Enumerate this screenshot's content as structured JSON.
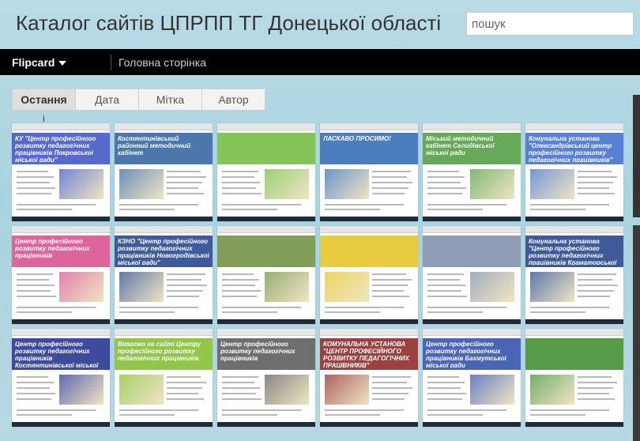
{
  "header": {
    "title": "Каталог сайтів ЦПРПП ТГ Донецької області",
    "search_placeholder": "пошук"
  },
  "navbar": {
    "view_label": "Flipcard",
    "home_label": "Головна сторінка"
  },
  "tabs": [
    {
      "label": "Остання",
      "active": true
    },
    {
      "label": "Дата",
      "active": false
    },
    {
      "label": "Мітка",
      "active": false
    },
    {
      "label": "Автор",
      "active": false
    }
  ],
  "tab_marker": "i",
  "cards": [
    {
      "name": "card-1",
      "headline": "КУ \"Центр професійного розвитку педагогічних працівників Покровської міської ради\"",
      "accent": "#3a4fc2"
    },
    {
      "name": "card-2",
      "headline": "Костянтинівський районний методичний кабінет",
      "accent": "#2c5f9e"
    },
    {
      "name": "card-3",
      "headline": "",
      "accent": "#6fba3c"
    },
    {
      "name": "card-4",
      "headline": "ЛАСКАВО ПРОСИМО!",
      "accent": "#2b67b3"
    },
    {
      "name": "card-5",
      "headline": "Міський методичний кабінет Селидівської міської ради",
      "accent": "#4a9a3c"
    },
    {
      "name": "card-6",
      "headline": "Комунальна установа \"Олександрівський центр професійного розвитку педагогічних працівників\"",
      "accent": "#3b6bc9"
    },
    {
      "name": "card-7",
      "headline": "Центр професійного розвитку педагогічних працівників",
      "accent": "#d84a8a"
    },
    {
      "name": "card-8",
      "headline": "КЗНО \"Центр професійного розвитку педагогічних працівників Новогродівської міської ради\"",
      "accent": "#1f3e8a"
    },
    {
      "name": "card-9",
      "headline": "",
      "accent": "#6c8c3a"
    },
    {
      "name": "card-10",
      "headline": "",
      "accent": "#e4c21c"
    },
    {
      "name": "card-11",
      "headline": "",
      "accent": "#7c8aa8"
    },
    {
      "name": "card-12",
      "headline": "Комунальна установа \"Центр професійного розвитку педагогічних працівників Краматорської міської ради\"",
      "accent": "#1d3d8a"
    },
    {
      "name": "card-13",
      "headline": "Центр професійного розвитку педагогічних працівників Костянтинівської міської ради",
      "accent": "#1c2a8c"
    },
    {
      "name": "card-14",
      "headline": "Вітаємо на сайті Центру професійного розвитку педагогічних працівників",
      "accent": "#7ebc2a"
    },
    {
      "name": "card-15",
      "headline": "Центр професійного розвитку педагогічних працівників",
      "accent": "#555555"
    },
    {
      "name": "card-16",
      "headline": "КОМУНАЛЬНА УСТАНОВА \"ЦЕНТР ПРОФЕСІЙНОГО РОЗВИТКУ ПЕДАГОГІЧНИХ ПРАЦІВНИКІВ\"",
      "accent": "#8a2020"
    },
    {
      "name": "card-17",
      "headline": "Центр професійного розвитку педагогічних працівників Бахмутської міської ради",
      "accent": "#2b4aa8"
    },
    {
      "name": "card-18",
      "headline": "",
      "accent": "#3a8a2a"
    }
  ]
}
